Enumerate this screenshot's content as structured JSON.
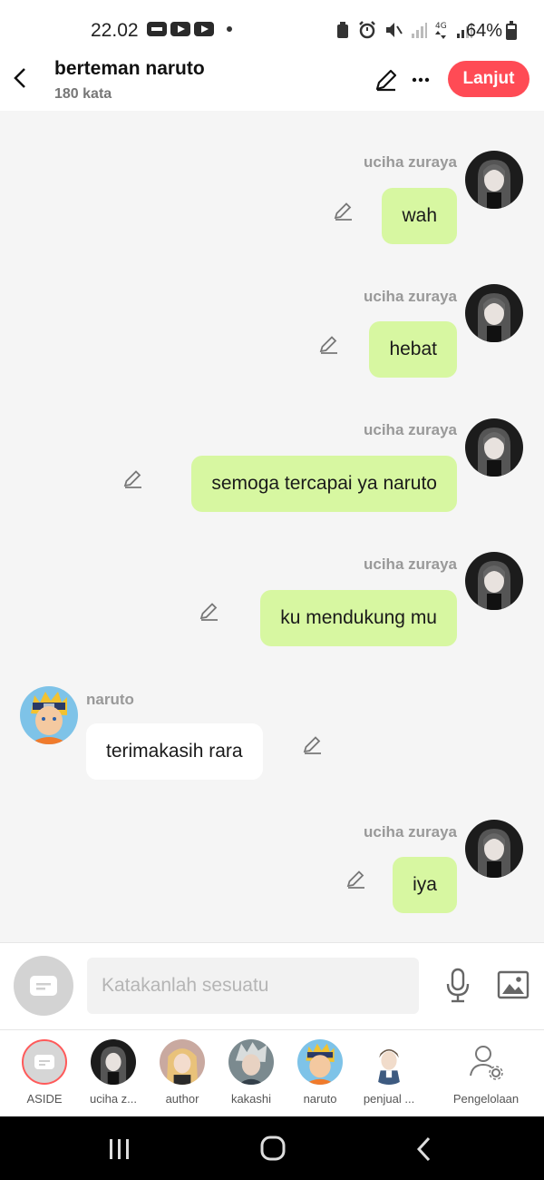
{
  "status_bar": {
    "time": "22.02",
    "battery": "64%"
  },
  "header": {
    "title": "berteman naruto",
    "subtitle": "180 kata",
    "continue_label": "Lanjut"
  },
  "messages": [
    {
      "side": "right",
      "name": "uciha zuraya",
      "text": "wah"
    },
    {
      "side": "right",
      "name": "uciha zuraya",
      "text": "hebat"
    },
    {
      "side": "right",
      "name": "uciha zuraya",
      "text": "semoga tercapai ya naruto"
    },
    {
      "side": "right",
      "name": "uciha zuraya",
      "text": "ku mendukung mu"
    },
    {
      "side": "left",
      "name": "naruto",
      "text": "terimakasih rara"
    },
    {
      "side": "right",
      "name": "uciha zuraya",
      "text": "iya"
    }
  ],
  "composer": {
    "placeholder": "Katakanlah sesuatu"
  },
  "characters": [
    {
      "label": "ASIDE",
      "icon": "aside-icon"
    },
    {
      "label": "uciha z...",
      "icon": "uciha-zuraya-avatar"
    },
    {
      "label": "author",
      "icon": "author-avatar"
    },
    {
      "label": "kakashi",
      "icon": "kakashi-avatar"
    },
    {
      "label": "naruto",
      "icon": "naruto-avatar"
    },
    {
      "label": "penjual ...",
      "icon": "penjual-avatar"
    },
    {
      "label": "Pengelolaan",
      "icon": "manage-characters-icon"
    }
  ],
  "colors": {
    "accent": "#ff4b55",
    "bubble_right": "#d7f7a1",
    "bubble_left": "#ffffff",
    "chat_bg": "#f5f5f5"
  }
}
